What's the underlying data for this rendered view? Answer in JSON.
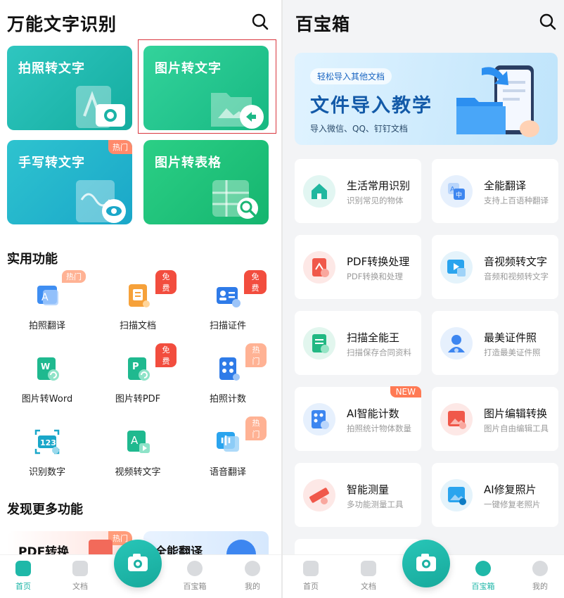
{
  "left": {
    "title": "万能文字识别",
    "cards": [
      {
        "label": "拍照转文字"
      },
      {
        "label": "图片转文字"
      },
      {
        "label": "手写转文字",
        "badge": "热门"
      },
      {
        "label": "图片转表格"
      }
    ],
    "section_practical": "实用功能",
    "features": [
      {
        "label": "拍照翻译",
        "badge": "热门"
      },
      {
        "label": "扫描文档",
        "badge": "免费"
      },
      {
        "label": "扫描证件",
        "badge": "免费"
      },
      {
        "label": "图片转Word"
      },
      {
        "label": "图片转PDF",
        "badge": "免费"
      },
      {
        "label": "拍照计数",
        "badge": "热门"
      },
      {
        "label": "识别数字"
      },
      {
        "label": "视频转文字"
      },
      {
        "label": "语音翻译",
        "badge": "热门"
      }
    ],
    "section_more": "发现更多功能",
    "more": [
      {
        "label": "PDF转换",
        "badge": "热门"
      },
      {
        "label": "全能翻译"
      }
    ],
    "tabs": [
      "首页",
      "文档",
      "百宝箱",
      "我的"
    ],
    "active_tab": "首页"
  },
  "right": {
    "title": "百宝箱",
    "banner": {
      "tag": "轻松导入其他文档",
      "headline": "文件导入教学",
      "sub": "导入微信、QQ、钉钉文档"
    },
    "tools": [
      {
        "title": "生活常用识别",
        "sub": "识别常见的物体"
      },
      {
        "title": "全能翻译",
        "sub": "支持上百语种翻译"
      },
      {
        "title": "PDF转换处理",
        "sub": "PDF转换和处理"
      },
      {
        "title": "音视频转文字",
        "sub": "音频和视频转文字"
      },
      {
        "title": "扫描全能王",
        "sub": "扫描保存合同资料"
      },
      {
        "title": "最美证件照",
        "sub": "打造最美证件照"
      },
      {
        "title": "AI智能计数",
        "sub": "拍照统计物体数量",
        "badge": "NEW"
      },
      {
        "title": "图片编辑转换",
        "sub": "图片自由编辑工具"
      },
      {
        "title": "智能测量",
        "sub": "多功能测量工具"
      },
      {
        "title": "AI修复照片",
        "sub": "一键修复老照片"
      }
    ],
    "tabs": [
      "首页",
      "文档",
      "百宝箱",
      "我的"
    ],
    "active_tab": "百宝箱"
  },
  "colors": {
    "accent": "#19b4a6",
    "hot": "#ffb294",
    "free": "#f24d3e",
    "highlight": "#d9363e"
  }
}
